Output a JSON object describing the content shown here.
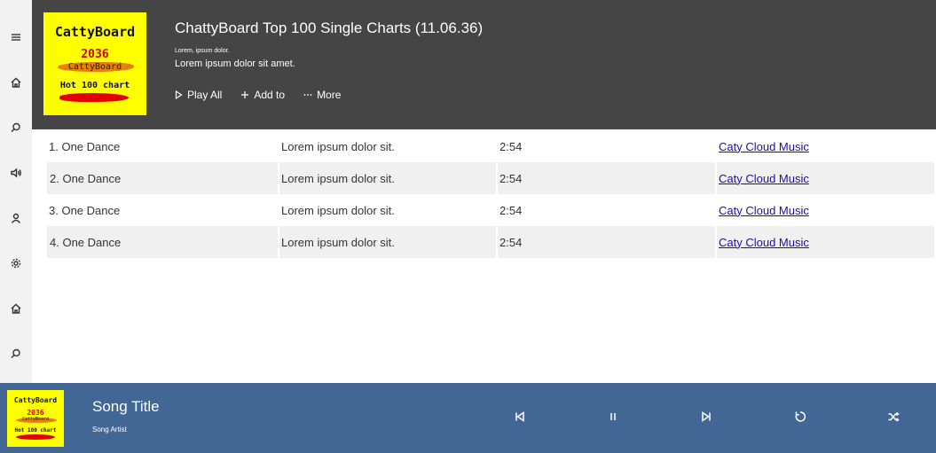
{
  "sidebar": {
    "icons": [
      "menu-icon",
      "home-icon",
      "search-icon",
      "speaker-icon",
      "user-icon",
      "gear-icon",
      "home-icon",
      "search-icon"
    ]
  },
  "header": {
    "cover": {
      "brand": "CattyBoard",
      "year": "2036",
      "sub": "CattyBoard",
      "hot": "Hot 100 chart"
    },
    "title": "ChattyBoard Top 100 Single Charts (11.06.36)",
    "small_text": "Lorem, ipsum dolor.",
    "description": "Lorem ipsum dolor sit amet.",
    "actions": {
      "play_all": "Play All",
      "add_to": "Add to",
      "more": "More"
    }
  },
  "tracks": [
    {
      "title": "1. One Dance",
      "description": "Lorem ipsum dolor sit.",
      "duration": "2:54",
      "label": "Caty Cloud Music"
    },
    {
      "title": "2. One Dance",
      "description": "Lorem ipsum dolor sit.",
      "duration": "2:54",
      "label": "Caty Cloud Music"
    },
    {
      "title": "3. One Dance",
      "description": "Lorem ipsum dolor sit.",
      "duration": "2:54",
      "label": "Caty Cloud Music"
    },
    {
      "title": "4. One Dance",
      "description": "Lorem ipsum dolor sit.",
      "duration": "2:54",
      "label": "Caty Cloud Music"
    }
  ],
  "player": {
    "cover": {
      "brand": "CattyBoard",
      "year": "2036",
      "sub": "CattyBoard",
      "hot": "Hot 100 chart"
    },
    "song_title": "Song Title",
    "song_artist": "Song Artist",
    "controls": [
      "previous-icon",
      "pause-icon",
      "next-icon",
      "repeat-icon",
      "shuffle-icon"
    ]
  },
  "colors": {
    "header_bg": "#454545",
    "player_bg": "#436795",
    "sidebar_bg": "#f2f2f2",
    "cover_yellow": "#ffff00",
    "link": "#1a0dab"
  }
}
